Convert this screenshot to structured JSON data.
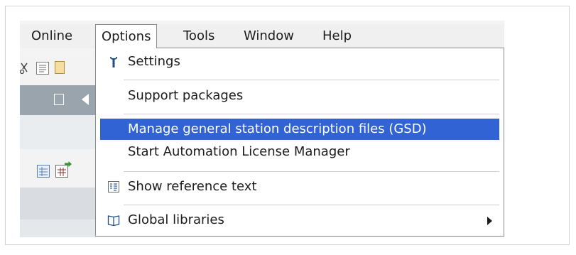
{
  "menubar": {
    "items": [
      {
        "label": "Online"
      },
      {
        "label": "Options"
      },
      {
        "label": "Tools"
      },
      {
        "label": "Window"
      },
      {
        "label": "Help"
      }
    ],
    "active_item": "Options"
  },
  "options_menu": {
    "items": [
      {
        "label": "Settings",
        "icon": "wrench-icon"
      },
      {
        "label": "Support packages"
      },
      {
        "label": "Manage general station description files (GSD)",
        "highlighted": true
      },
      {
        "label": "Start Automation License Manager"
      },
      {
        "label": "Show reference text",
        "icon": "reference-text-icon"
      },
      {
        "label": "Global libraries",
        "icon": "book-icon",
        "has_submenu": true
      }
    ]
  },
  "colors": {
    "highlight": "#3263d4",
    "menu_border": "#8a8a8a",
    "dark_toolbar": "#9aa4ad"
  }
}
